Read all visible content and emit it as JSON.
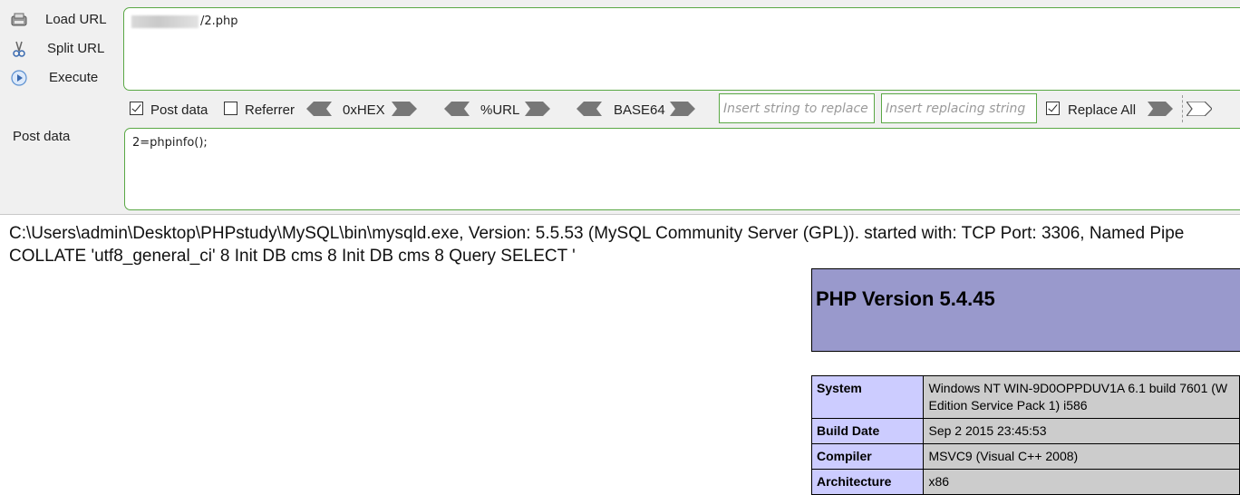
{
  "sidebar": {
    "load_url": "Load URL",
    "split_url": "Split URL",
    "execute": "Execute"
  },
  "url_field": {
    "value": "/2.php"
  },
  "options": {
    "post_data": {
      "label": "Post data",
      "checked": true
    },
    "referrer": {
      "label": "Referrer",
      "checked": false
    },
    "hex": "0xHEX",
    "url": "%URL",
    "base64": "BASE64",
    "replace_string_placeholder": "Insert string to replace",
    "replacing_string_placeholder": "Insert replacing string",
    "replace_all": {
      "label": "Replace All",
      "checked": true
    }
  },
  "post": {
    "label": "Post data",
    "value": "2=phpinfo();"
  },
  "output": {
    "line1": "C:\\Users\\admin\\Desktop\\PHPstudy\\MySQL\\bin\\mysqld.exe, Version: 5.5.53 (MySQL Community Server (GPL)). started with: TCP Port: 3306, Named Pipe",
    "line2": "COLLATE 'utf8_general_ci' 8 Init DB cms 8 Init DB cms 8 Query SELECT '"
  },
  "phpinfo": {
    "title": "PHP Version 5.4.45",
    "rows": [
      {
        "key": "System",
        "value": "Windows NT WIN-9D0OPPDUV1A 6.1 build 7601 (W",
        "value2": "Edition Service Pack 1) i586"
      },
      {
        "key": "Build Date",
        "value": "Sep 2 2015 23:45:53"
      },
      {
        "key": "Compiler",
        "value": "MSVC9 (Visual C++ 2008)"
      },
      {
        "key": "Architecture",
        "value": "x86"
      }
    ]
  },
  "colors": {
    "accent_border": "#5aa845",
    "php_header": "#9999cc",
    "php_key": "#ccccff",
    "php_value": "#cccccc"
  }
}
